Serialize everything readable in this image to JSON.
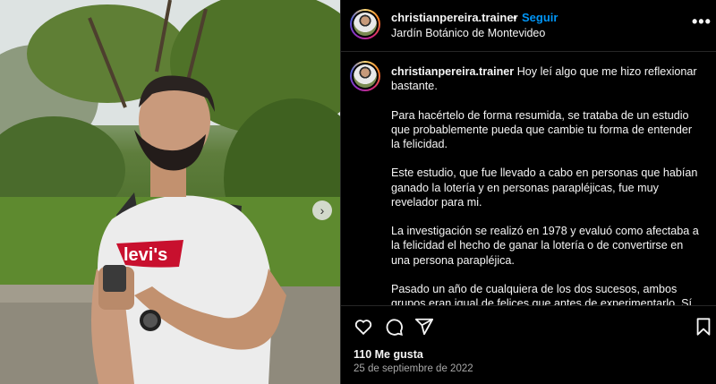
{
  "post": {
    "username": "christianpereira.trainer",
    "separator": "•",
    "follow_label": "Seguir",
    "location": "Jardín Botánico de Montevideo",
    "more_label": "•••"
  },
  "caption": {
    "username": "christianpereira.trainer",
    "paragraphs": [
      "Hoy leí algo que me hizo reflexionar bastante.",
      "Para hacértelo de forma resumida, se trataba de un estudio que probablemente pueda que cambie tu forma de entender la felicidad.",
      "Este estudio, que fue llevado a cabo en personas que habían ganado la lotería y en personas parapléjicas, fue muy revelador para mi.",
      "La investigación se realizó en 1978 y evaluó como afectaba a la felicidad el hecho de ganar la lotería o de convertirse en una persona parapléjica.",
      "Pasado un año de cualquiera de los dos sucesos, ambos grupos eran igual de felices que antes de experimentarlo. Sí, seguro has leído bien, igual de felices (o de infelices)."
    ]
  },
  "photo": {
    "shirt_logo": "levi's",
    "next_arrow": "›"
  },
  "actions": {
    "like_icon": "heart-icon",
    "comment_icon": "comment-icon",
    "share_icon": "send-icon",
    "save_icon": "bookmark-icon"
  },
  "likes_text": "110 Me gusta",
  "date_text": "25 de septiembre de 2022",
  "colors": {
    "background": "#000000",
    "text": "#f5f5f5",
    "link": "#0095f6",
    "muted": "#a8a8a8",
    "divider": "#262626",
    "shirt_logo_red": "#c8102e"
  }
}
